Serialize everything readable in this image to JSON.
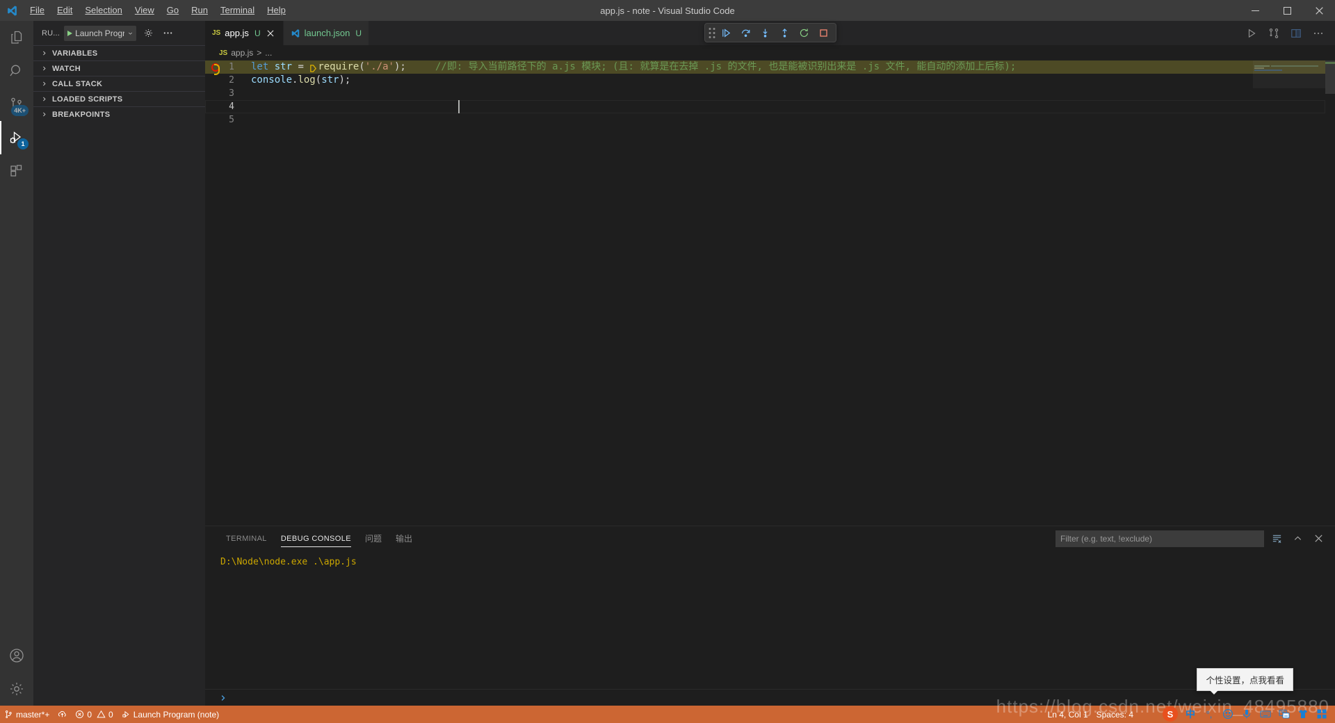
{
  "window": {
    "title": "app.js - note - Visual Studio Code",
    "minimize_label": "Minimize",
    "maximize_label": "Restore",
    "close_label": "Close"
  },
  "menubar": [
    {
      "label": "File",
      "mnemonic": "F"
    },
    {
      "label": "Edit",
      "mnemonic": "E"
    },
    {
      "label": "Selection",
      "mnemonic": "S"
    },
    {
      "label": "View",
      "mnemonic": "V"
    },
    {
      "label": "Go",
      "mnemonic": "G"
    },
    {
      "label": "Run",
      "mnemonic": "R"
    },
    {
      "label": "Terminal",
      "mnemonic": "T"
    },
    {
      "label": "Help",
      "mnemonic": "H"
    }
  ],
  "activitybar": {
    "items": [
      {
        "name": "explorer",
        "icon": "files-icon",
        "badge": ""
      },
      {
        "name": "search",
        "icon": "search-icon",
        "badge": ""
      },
      {
        "name": "source-control",
        "icon": "source-control-icon",
        "badge": "4K+"
      },
      {
        "name": "run-and-debug",
        "icon": "debug-alt-icon",
        "badge": "1",
        "active": true
      },
      {
        "name": "extensions",
        "icon": "extensions-icon",
        "badge": ""
      }
    ],
    "bottom": [
      {
        "name": "accounts",
        "icon": "account-icon"
      },
      {
        "name": "manage",
        "icon": "gear-icon"
      }
    ]
  },
  "sidebar": {
    "title": "RU...",
    "launch_config": "Launch Progra",
    "start_debug_label": "Start Debugging",
    "gear_label": "Open launch.json",
    "more_label": "Views and More Actions...",
    "sections": [
      {
        "label": "VARIABLES",
        "expanded": false
      },
      {
        "label": "WATCH",
        "expanded": false
      },
      {
        "label": "CALL STACK",
        "expanded": false
      },
      {
        "label": "LOADED SCRIPTS",
        "expanded": false
      },
      {
        "label": "BREAKPOINTS",
        "expanded": false
      }
    ]
  },
  "tabs": [
    {
      "label": "app.js",
      "icon": "js-icon",
      "badge": "U",
      "active": true,
      "closeable": true
    },
    {
      "label": "launch.json",
      "icon": "vscode-icon",
      "badge": "U",
      "active": false,
      "closeable": false
    }
  ],
  "editor_actions": [
    {
      "name": "run-code",
      "icon": "play-icon"
    },
    {
      "name": "split-fork",
      "icon": "fork-icon"
    },
    {
      "name": "split-editor-right",
      "icon": "split-icon"
    },
    {
      "name": "more-actions",
      "icon": "ellipsis-icon"
    }
  ],
  "debug_toolbar": [
    {
      "name": "drag-handle",
      "icon": "grip-icon"
    },
    {
      "name": "continue",
      "icon": "debug-continue-icon",
      "color": "#75beff"
    },
    {
      "name": "step-over",
      "icon": "debug-step-over-icon",
      "color": "#75beff"
    },
    {
      "name": "step-into",
      "icon": "debug-step-into-icon",
      "color": "#75beff"
    },
    {
      "name": "step-out",
      "icon": "debug-step-out-icon",
      "color": "#75beff"
    },
    {
      "name": "restart",
      "icon": "debug-restart-icon",
      "color": "#89d185"
    },
    {
      "name": "stop",
      "icon": "debug-stop-icon",
      "color": "#f48771"
    }
  ],
  "breadcrumbs": {
    "file_icon": "js-icon",
    "file": "app.js",
    "separator": ">",
    "overflow": "..."
  },
  "editor": {
    "language": "javascript",
    "line_numbers": [
      "1",
      "2",
      "3",
      "4",
      "5"
    ],
    "current_line": 4,
    "breakpoint_line": 1,
    "highlight_line": 1,
    "lines": [
      {
        "num": "1",
        "tokens": [
          {
            "t": "let",
            "c": "k-let"
          },
          {
            "t": " ",
            "c": "k-op"
          },
          {
            "t": "str",
            "c": "k-var"
          },
          {
            "t": " = ",
            "c": "k-op"
          },
          {
            "t": "require",
            "c": "k-fn"
          },
          {
            "t": "(",
            "c": "k-pun"
          },
          {
            "t": "'./a'",
            "c": "k-str"
          },
          {
            "t": ")",
            "c": "k-pun"
          },
          {
            "t": ";",
            "c": "k-pun"
          },
          {
            "t": "    ",
            "c": "k-op"
          },
          {
            "t": "//即: 导入当前路径下的 a.js 模块; (且: 就算是在去掉 .js 的文件, 也是能被识别出来是 .js 文件, 能自动的添加上后标);",
            "c": "k-com"
          }
        ]
      },
      {
        "num": "2",
        "tokens": [
          {
            "t": "console",
            "c": "k-obj"
          },
          {
            "t": ".",
            "c": "k-pun"
          },
          {
            "t": "log",
            "c": "k-fn"
          },
          {
            "t": "(",
            "c": "k-pun"
          },
          {
            "t": "str",
            "c": "k-var"
          },
          {
            "t": ")",
            "c": "k-pun"
          },
          {
            "t": ";",
            "c": "k-pun"
          }
        ]
      },
      {
        "num": "3",
        "tokens": []
      },
      {
        "num": "4",
        "tokens": []
      },
      {
        "num": "5",
        "tokens": []
      }
    ]
  },
  "panel": {
    "tabs": [
      {
        "label": "TERMINAL",
        "active": false,
        "cjk": false
      },
      {
        "label": "DEBUG CONSOLE",
        "active": true,
        "cjk": false
      },
      {
        "label": "问题",
        "active": false,
        "cjk": true
      },
      {
        "label": "输出",
        "active": false,
        "cjk": true
      }
    ],
    "filter_placeholder": "Filter (e.g. text, !exclude)",
    "filter_value": "",
    "actions": [
      {
        "name": "clear-console",
        "icon": "clear-icon"
      },
      {
        "name": "maximize-panel",
        "icon": "chevron-up-icon"
      },
      {
        "name": "close-panel",
        "icon": "close-icon"
      }
    ],
    "console_lines": [
      "D:\\Node\\node.exe .\\app.js"
    ],
    "prompt_icon": "chevron-right-icon"
  },
  "statusbar": {
    "left": [
      {
        "name": "remote-branch",
        "icon": "source-control-icon",
        "label": "master*+"
      },
      {
        "name": "sync-changes",
        "icon": "cloud-sync-icon",
        "label": ""
      },
      {
        "name": "problems",
        "icon": "error-warning-icon",
        "label": "0  0",
        "errors": "0",
        "warnings": "0"
      },
      {
        "name": "debug-launch",
        "icon": "debug-alt-small-icon",
        "label": "Launch Program (note)"
      }
    ],
    "right": [
      {
        "name": "editor-position",
        "label": "Ln 4, Col 1"
      },
      {
        "name": "editor-indentation",
        "label": "Spaces: 4"
      }
    ],
    "background": "#cc6633"
  },
  "overlays": {
    "tooltip": "个性设置，点我看看",
    "watermark": "https://blog.csdn.net/weixin_48495880",
    "ime": {
      "logo": "S",
      "items": [
        {
          "name": "ime-mode-chinese",
          "label": "中"
        },
        {
          "name": "ime-punctuation",
          "label": "°,"
        },
        {
          "name": "ime-emoji",
          "label": "☺"
        },
        {
          "name": "ime-voice",
          "label": "mic"
        },
        {
          "name": "ime-keyboard",
          "label": "keyboard"
        },
        {
          "name": "ime-translate",
          "label": "translate"
        },
        {
          "name": "ime-skin",
          "label": "skin"
        },
        {
          "name": "ime-toolbox",
          "label": "toolbox"
        }
      ]
    }
  },
  "colors": {
    "accent": "#007acc",
    "statusbar": "#cc6633",
    "editor_bg": "#1e1e1e",
    "sidebar_bg": "#252526",
    "activitybar_bg": "#333333",
    "titlebar_bg": "#3c3c3c",
    "highlight_line": "#4d4a25",
    "comment": "#6a9955",
    "string": "#ce9178",
    "keyword": "#569cd6",
    "function": "#dcdcaa",
    "variable": "#9cdcfe",
    "console_text": "#cca700"
  }
}
